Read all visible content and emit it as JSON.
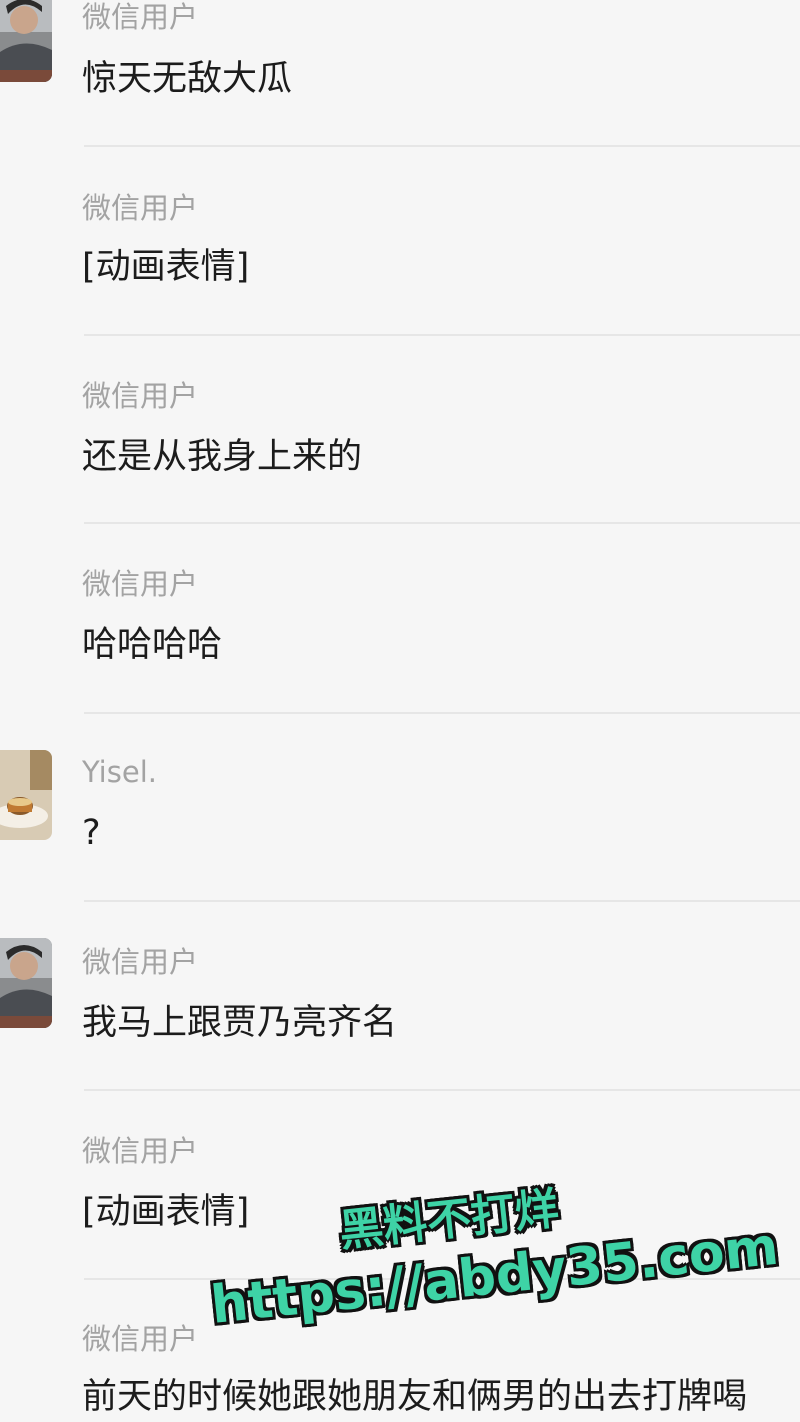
{
  "messages": [
    {
      "sender": "微信用户",
      "text": "惊天无敌大瓜",
      "avatar": "man-photo"
    },
    {
      "sender": "微信用户",
      "text": "[动画表情]",
      "avatar": ""
    },
    {
      "sender": "微信用户",
      "text": "还是从我身上来的",
      "avatar": ""
    },
    {
      "sender": "微信用户",
      "text": "哈哈哈哈",
      "avatar": ""
    },
    {
      "sender": "Yisel.",
      "text": "?",
      "avatar": "cake-photo"
    },
    {
      "sender": "微信用户",
      "text": "我马上跟贾乃亮齐名",
      "avatar": "man-photo"
    },
    {
      "sender": "微信用户",
      "text": "[动画表情]",
      "avatar": ""
    },
    {
      "sender": "微信用户",
      "text": "前天的时候她跟她朋友和俩男的出去打牌喝",
      "avatar": ""
    }
  ],
  "watermark": {
    "line1": "黑料不打烊",
    "line2": "https://abdy35.com"
  },
  "colors": {
    "background": "#f6f6f6",
    "sender": "#a3a3a3",
    "text": "#1c1c1c",
    "divider": "#e6e6e6",
    "watermark": "#3ed3a6"
  }
}
